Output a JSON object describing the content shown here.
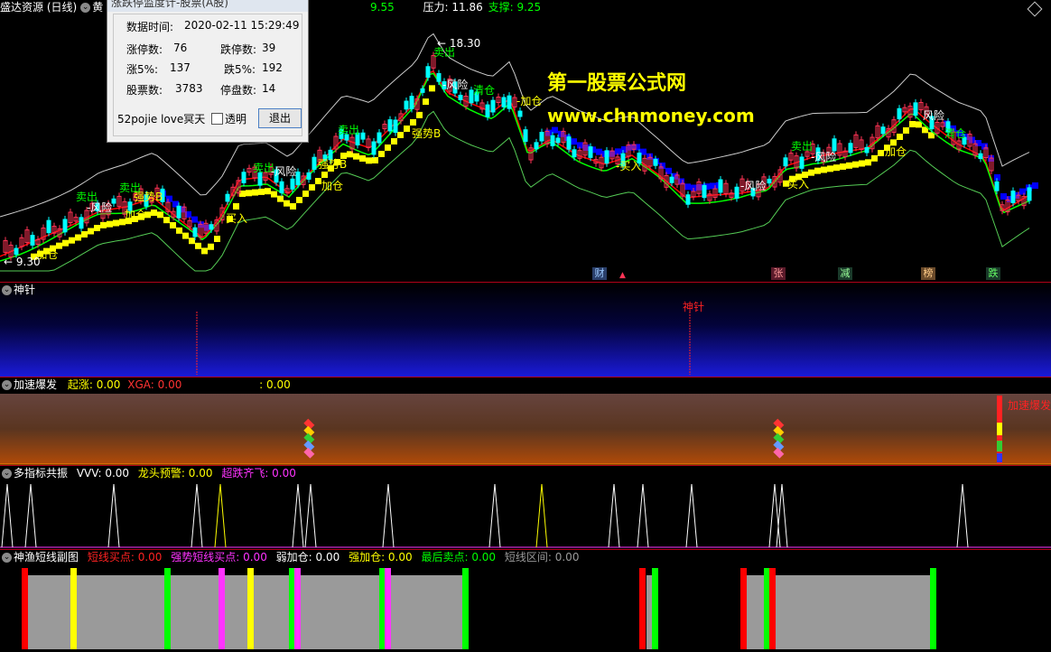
{
  "main": {
    "title": "盛达资源 (日线)",
    "icon_label": "黄",
    "val1": "9.55",
    "pressure_label": "压力: 11.86",
    "support_label": "支撑: 9.25",
    "high_price": "18.30",
    "low_price": "9.30",
    "labels": {
      "maichu": "卖出",
      "fengxian": "风险",
      "qingcang": "清仓",
      "jiacang": "加仓",
      "qiangshi": "强势B",
      "qiangshi2": "强势B",
      "mairu": "买入",
      "mairu2": "买入"
    },
    "event_markers": [
      "财",
      "张",
      "减",
      "榜",
      "跌"
    ]
  },
  "dialog": {
    "title": "涨跌停监度计-股票(A股)",
    "time_label": "数据时间:",
    "time_value": "2020-02-11 15:29:49",
    "limit_up_label": "涨停数:",
    "limit_up_value": "76",
    "limit_down_label": "跌停数:",
    "limit_down_value": "39",
    "up5_label": "涨5%:",
    "up5_value": "137",
    "down5_label": "跌5%:",
    "down5_value": "192",
    "stocks_label": "股票数:",
    "stocks_value": "3783",
    "halt_label": "停盘数:",
    "halt_value": "14",
    "signature": "52pojie love冥天",
    "transparent_label": "透明",
    "exit_label": "退出"
  },
  "watermark": {
    "line1": "第一股票公式网",
    "line2": "www.chnmoney.com"
  },
  "pane_shenzhen": {
    "title": "神针",
    "marker": "神针"
  },
  "pane_accel": {
    "title": "加速爆发",
    "qizhang": "起涨: 0.00",
    "xga": "XGA: 0.00",
    "colon_val": ": 0.00",
    "right_label": "加速爆发"
  },
  "pane_multi": {
    "title": "多指标共振",
    "vvv": "VVV: 0.00",
    "longtou": "龙头预警: 0.00",
    "chaodie": "超跌齐飞: 0.00"
  },
  "pane_fish": {
    "title": "神渔短线副图",
    "l1": "短线买点: 0.00",
    "l2": "强势短线买点: 0.00",
    "l3": "弱加仓: 0.00",
    "l4": "强加仓: 0.00",
    "l5": "最后卖点: 0.00",
    "l6": "短线区间: 0.00"
  },
  "colors": {
    "up": "#ff3355",
    "down": "#00ffff",
    "ma_red": "#ff0000",
    "ma_green": "#00ff00",
    "ma_yellow": "#ffff00",
    "ma_blue": "#0000ff",
    "band_green": "#55cc55",
    "band_white": "#ffffff",
    "grid_red": "#b0001a"
  }
}
